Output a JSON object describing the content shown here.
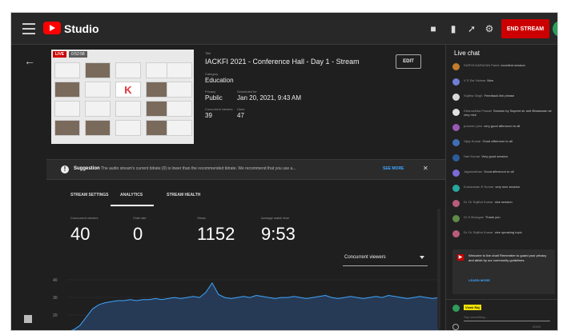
{
  "header": {
    "app_name": "Studio",
    "end_stream_label": "END STREAM"
  },
  "icons": {
    "menu": "hamburger-icon",
    "back": "arrow-left-icon",
    "camera": "camera-icon",
    "notify": "bell-icon",
    "share": "share-icon",
    "settings": "gear-icon",
    "feedback": "feedback-icon"
  },
  "colors": {
    "brand": "#ff0000",
    "end_stream": "#cc0000",
    "accent": "#3ea6ff",
    "chart_line": "#3ea6ff",
    "chart_fill": "#263a55"
  },
  "preview": {
    "live_label": "LIVE",
    "live_time": "0:52:58",
    "logo_letter": "K"
  },
  "stream_info": {
    "title_label": "Title",
    "title": "IACKFI 2021 - Conference Hall - Day 1 - Stream",
    "category_label": "Category",
    "category": "Education",
    "privacy_label": "Privacy",
    "privacy": "Public",
    "scheduled_label": "Scheduled for",
    "scheduled": "Jan 20, 2021, 9:43 AM",
    "concurrent_label": "Concurrent viewers",
    "concurrent": "39",
    "likes_label": "Likes",
    "likes": "47",
    "edit_label": "EDIT"
  },
  "suggestion": {
    "title": "Suggestion",
    "text": "The audio stream's current bitrate (0) is lower than the recommended bitrate. We recommend that you use a...",
    "link": "SEE MORE",
    "close": "✕"
  },
  "tabs": [
    "STREAM SETTINGS",
    "ANALYTICS",
    "STREAM HEALTH"
  ],
  "stats": [
    {
      "label": "Concurrent viewers",
      "value": "40"
    },
    {
      "label": "Chat rate",
      "value": "0"
    },
    {
      "label": "Views",
      "value": "1152"
    },
    {
      "label": "Average watch time",
      "value": "9:53"
    }
  ],
  "metric_dropdown": "Concurrent viewers",
  "chart_data": {
    "type": "area",
    "ylabel_ticks": [
      "40",
      "30",
      "20"
    ],
    "values": [
      0,
      2,
      6,
      14,
      22,
      26,
      28,
      29,
      30,
      30,
      31,
      30,
      31,
      31,
      32,
      31,
      32,
      33,
      32,
      33,
      34,
      33,
      38,
      47,
      36,
      33,
      32,
      33,
      34,
      33,
      35,
      34,
      33,
      32,
      33,
      33,
      34,
      33,
      32,
      33,
      34,
      35,
      33,
      32,
      33,
      34,
      33,
      32,
      33,
      34,
      33,
      35,
      34,
      33,
      32,
      33,
      34,
      33,
      32,
      33
    ],
    "ylim": [
      0,
      50
    ]
  },
  "chat": {
    "title": "Live chat",
    "messages": [
      {
        "name": "SURYA NARAYAN Pandi",
        "text": "excellent session",
        "color": "#c27c2c"
      },
      {
        "name": "V S Sai Vishwa",
        "text": "Nice",
        "color": "#6e7fd6"
      },
      {
        "name": "Sujitha Singh",
        "text": "Feedback link please",
        "color": "#d8d8d8"
      },
      {
        "name": "Dhanushika Prasad",
        "text": "Session by Sayeed sir and Bhaskaran sir very nice",
        "color": "#e0e0e0"
      },
      {
        "name": "praveen john",
        "text": "very good afternoon to all",
        "color": "#9b59b6"
      },
      {
        "name": "Vijay Kumar",
        "text": "Good afternoon to all",
        "color": "#3d6fb6"
      },
      {
        "name": "Hari Kumar",
        "text": "Very good session",
        "color": "#2c5d9a"
      },
      {
        "name": "Jagannathan",
        "text": "Good afternoon to all",
        "color": "#7a6ad8"
      },
      {
        "name": "Kumaresan R Kumar",
        "text": "very nice session",
        "color": "#27a7a0"
      },
      {
        "name": "Dr. Dr Sujitha Kumar",
        "text": "nice session",
        "color": "#b85b7c"
      },
      {
        "name": "Dr S Murugan",
        "text": "Thank you",
        "color": "#5f8a4a"
      },
      {
        "name": "Dr. Dr Sujitha Kumar",
        "text": "nice speaking topic",
        "color": "#b85b7c"
      }
    ],
    "notice_text": "Welcome to live chat! Remember to guard your privacy and abide by our community guidelines.",
    "notice_link": "LEARN MORE",
    "me_name": "Vivek Raj",
    "input_placeholder": "Say something...",
    "char_count": "0/200"
  }
}
